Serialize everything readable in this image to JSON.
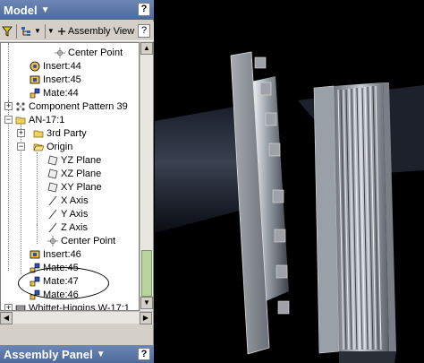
{
  "panel": {
    "title": "Model",
    "help": "?"
  },
  "toolbar": {
    "filter_icon": "funnel-icon",
    "view_label": "Assembly View",
    "help": "?"
  },
  "tree": {
    "items": [
      {
        "label": "Center Point",
        "icon": "center-point-icon"
      },
      {
        "label": "Insert:44",
        "icon": "insert-constraint-icon"
      },
      {
        "label": "Insert:45",
        "icon": "insert-constraint-icon"
      },
      {
        "label": "Mate:44",
        "icon": "mate-constraint-icon"
      },
      {
        "label": "Component Pattern 39",
        "icon": "pattern-icon"
      },
      {
        "label": "AN-17:1",
        "icon": "folder-icon"
      },
      {
        "label": "3rd Party",
        "icon": "folder-icon"
      },
      {
        "label": "Origin",
        "icon": "open-folder-icon"
      },
      {
        "label": "YZ Plane",
        "icon": "plane-icon"
      },
      {
        "label": "XZ Plane",
        "icon": "plane-icon"
      },
      {
        "label": "XY Plane",
        "icon": "plane-icon"
      },
      {
        "label": "X Axis",
        "icon": "axis-icon"
      },
      {
        "label": "Y Axis",
        "icon": "axis-icon"
      },
      {
        "label": "Z Axis",
        "icon": "axis-icon"
      },
      {
        "label": "Center Point",
        "icon": "center-point-icon"
      },
      {
        "label": "Insert:46",
        "icon": "insert-constraint-icon"
      },
      {
        "label": "Mate:45",
        "icon": "mate-constraint-icon"
      },
      {
        "label": "Mate:47",
        "icon": "mate-constraint-icon"
      },
      {
        "label": "Mate:46",
        "icon": "mate-constraint-icon"
      },
      {
        "label": "Whittet-Higgins W-17:1",
        "icon": "part-icon"
      }
    ]
  },
  "bottom_panel": {
    "title": "Assembly Panel",
    "help": "?"
  }
}
